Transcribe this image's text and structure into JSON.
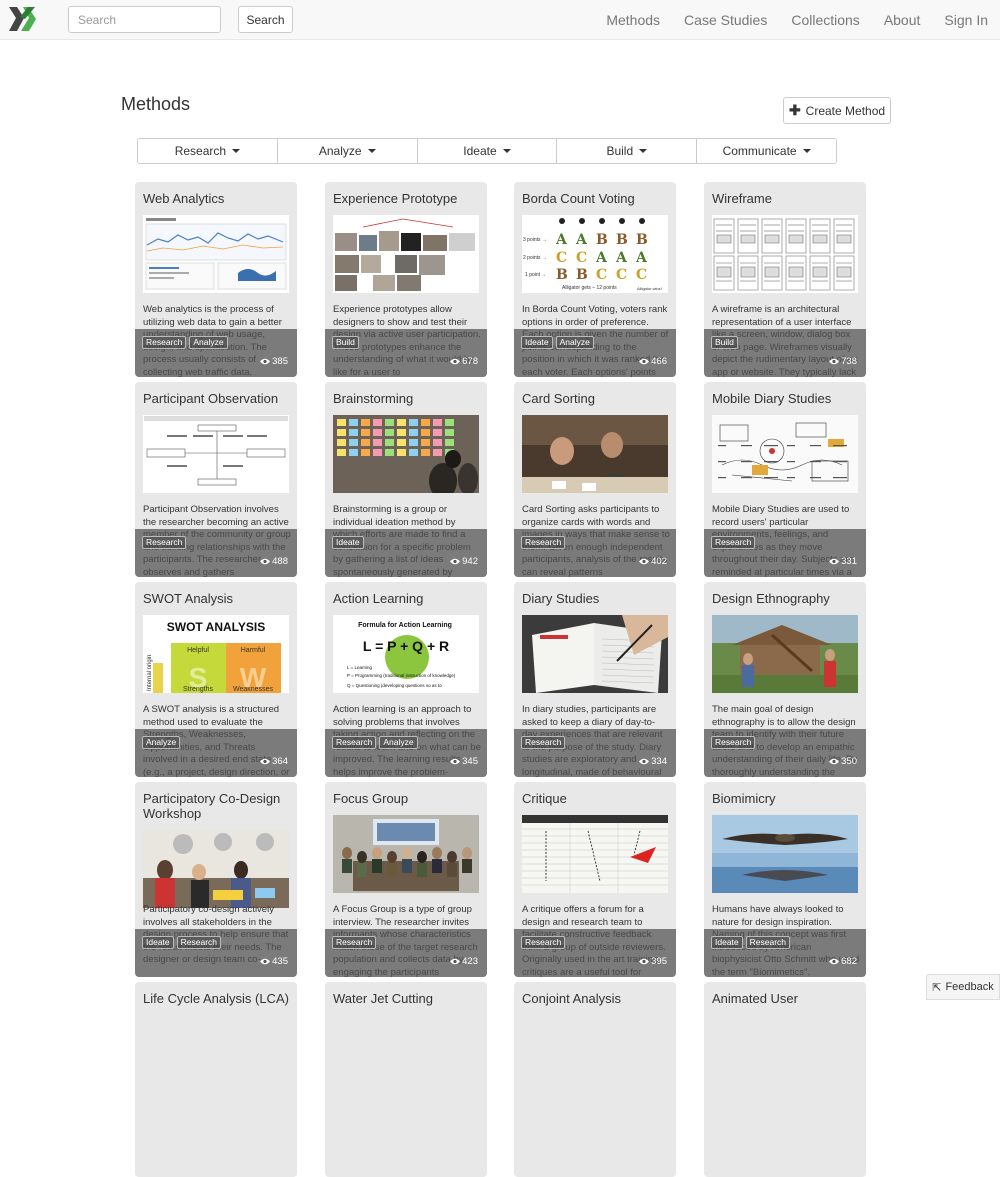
{
  "nav": {
    "search_placeholder": "Search",
    "search_button": "Search",
    "links": [
      "Methods",
      "Case Studies",
      "Collections",
      "About",
      "Sign In"
    ]
  },
  "header": {
    "title": "Methods",
    "create_button": "Create Method"
  },
  "filters": [
    "Research",
    "Analyze",
    "Ideate",
    "Build",
    "Communicate"
  ],
  "cards": [
    {
      "title": "Web Analytics",
      "image": "analytics-dashboard",
      "desc": "Web analytics is the process of utilizing web data to gain a better understanding of web usage, design, and optimization. The process usually consists of collecting web traffic data,",
      "tags": [
        "Research",
        "Analyze"
      ],
      "views": "385"
    },
    {
      "title": "Experience Prototype",
      "image": "prototype-collage",
      "desc": "Experience prototypes allow designers to show and test their design via active user participation. These prototypes enhance the understanding of what it would be like for a user to",
      "tags": [
        "Build"
      ],
      "views": "678"
    },
    {
      "title": "Borda Count Voting",
      "image": "borda-chart",
      "desc": "In Borda Count Voting, voters rank options in order of preference. Each option is given the number of points corresponding to the position in which it was ranked by each voter. Each options' points",
      "tags": [
        "Ideate",
        "Analyze"
      ],
      "views": "466"
    },
    {
      "title": "Wireframe",
      "image": "wireframe-grid",
      "desc": "A wireframe is an architectural representation of a user interface like a screen, window, dialog box or web page. Wireframes visually depict the rudimentary layout of an app or website. They typically lack",
      "tags": [
        "Build"
      ],
      "views": "738"
    },
    {
      "title": "Participant Observation",
      "image": "observation-diagram",
      "desc": "Participant Observation involves the researcher becoming an active member of the community or group and building relationships with the participants. The researcher observes and gathers",
      "tags": [
        "Research"
      ],
      "views": "488"
    },
    {
      "title": "Brainstorming",
      "image": "sticky-notes-photo",
      "desc": "Brainstorming is a group or individual ideation method by which efforts are made to find a conclusion for a specific problem by gathering a list of ideas spontaneously generated by",
      "tags": [
        "Ideate"
      ],
      "views": "942"
    },
    {
      "title": "Card Sorting",
      "image": "card-sorting-photo",
      "desc": "Card Sorting asks participants to organize cards with words and images in ways that make sense to them. Given enough independent participants, analysis of the results can reveal patterns",
      "tags": [
        "Research"
      ],
      "views": "402"
    },
    {
      "title": "Mobile Diary Studies",
      "image": "sketch-notes",
      "desc": "Mobile Diary Studies are used to record users' particular environments, feelings, and experiences as they move throughout their day. Subjects are reminded at particular times via a",
      "tags": [
        "Research"
      ],
      "views": "331"
    },
    {
      "title": "SWOT Analysis",
      "image": "swot-matrix",
      "desc": "A SWOT analysis is a structured method used to evaluate the Strengths, Weaknesses, Opportunities, and Threats involved in a desired end state (e.g., a project, design direction, or",
      "tags": [
        "Analyze"
      ],
      "views": "364"
    },
    {
      "title": "Action Learning",
      "image": "action-formula",
      "desc": "Action learning is an approach to solving problems that involves taking action and reflecting on the results to learn and on what can be improved. The learning results helps improve the problem-",
      "tags": [
        "Research",
        "Analyze"
      ],
      "views": "345"
    },
    {
      "title": "Diary Studies",
      "image": "diary-photo",
      "desc": "In diary studies, participants are asked to keep a diary of day-to-day experiences that are relevant to the purpose of the study. Diary studies are exploratory and longitudinal, made of behavioural",
      "tags": [
        "Research"
      ],
      "views": "334"
    },
    {
      "title": "Design Ethnography",
      "image": "ethnography-photo",
      "desc": "The main goal of design ethnography is to allow the design team to identify with their future users and to develop an empathic understanding of their daily life. By thoroughly understanding the",
      "tags": [
        "Research"
      ],
      "views": "350"
    },
    {
      "title": "Participatory Co-Design Workshop",
      "image": "workshop-photo",
      "desc": "Participatory co-design actively involves all stakeholders in the design process to help ensure that the result meets their needs. The designer or design team co-",
      "tags": [
        "Ideate",
        "Research"
      ],
      "views": "435"
    },
    {
      "title": "Focus Group",
      "image": "focus-group-photo",
      "desc": "A Focus Group is a type of group interview. The researcher invites informants whose characteristics match those of the target research population and collects data by engaging the participants",
      "tags": [
        "Research"
      ],
      "views": "423"
    },
    {
      "title": "Critique",
      "image": "critique-chart",
      "desc": "A critique offers a forum for a design and research team to facilitate constructive feedback from a group of outside reviewers. Originally used in the art training, critiques are a useful tool for",
      "tags": [
        "Research"
      ],
      "views": "395"
    },
    {
      "title": "Biomimicry",
      "image": "biomimicry-photo",
      "desc": "Humans have always looked to nature for design inspiration. Naming of this concept was first introduced by American biophysicist Otto Schmitt who used the term \"Biomimetics\".",
      "tags": [
        "Ideate",
        "Research"
      ],
      "views": "682"
    },
    {
      "title": "Life Cycle Analysis (LCA)",
      "image": "",
      "desc": "",
      "tags": [],
      "views": ""
    },
    {
      "title": "Water Jet Cutting",
      "image": "",
      "desc": "",
      "tags": [],
      "views": ""
    },
    {
      "title": "Conjoint Analysis",
      "image": "",
      "desc": "",
      "tags": [],
      "views": ""
    },
    {
      "title": "Animated User",
      "image": "",
      "desc": "",
      "tags": [],
      "views": ""
    }
  ],
  "images": {
    "swot": {
      "title": "SWOT ANALYSIS",
      "helpful": "Helpful",
      "harmful": "Harmful",
      "strengths": "Strengths",
      "weaknesses": "Weaknesses",
      "origin": "Internal origin"
    },
    "action": {
      "title": "Formula for Action Learning",
      "formula": "L = P + Q + R",
      "l_line": "L = Learning",
      "p_line": "P = Programming (traditional instruction of knowledge)",
      "q_line": "Q = Questioning (developing questions so as to"
    },
    "borda": {
      "rows": [
        "3 points",
        "2 points",
        "1 point"
      ],
      "caption": "Alligator gets – 12 points",
      "caption2": "Alligator wins!"
    }
  },
  "feedback": "Feedback",
  "colors": {
    "accent": "#5cb85c",
    "nav_bg": "#f8f8f8",
    "card_bg": "#e8e8e8"
  }
}
